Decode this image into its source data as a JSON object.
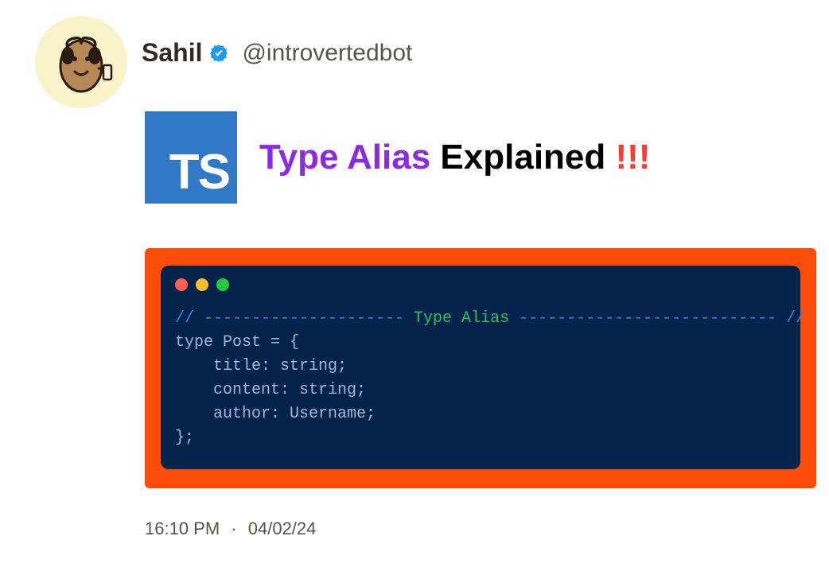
{
  "profile": {
    "display_name": "Sahil",
    "handle": "@introvertedbot"
  },
  "ts_badge": "TS",
  "title": {
    "part1": "Type Alias",
    "part2": "Explained",
    "part3": "!!!"
  },
  "code": {
    "banner_prefix": "// ---------------------",
    "banner_label": " Type Alias ",
    "banner_suffix": "--------------------------- //",
    "line1": "type Post = {",
    "line2": "    title: string;",
    "line3": "    content: string;",
    "line4": "    author: Username;",
    "line5": "};"
  },
  "footer": {
    "time": "16:10 PM",
    "sep": "·",
    "date": "04/02/24"
  }
}
